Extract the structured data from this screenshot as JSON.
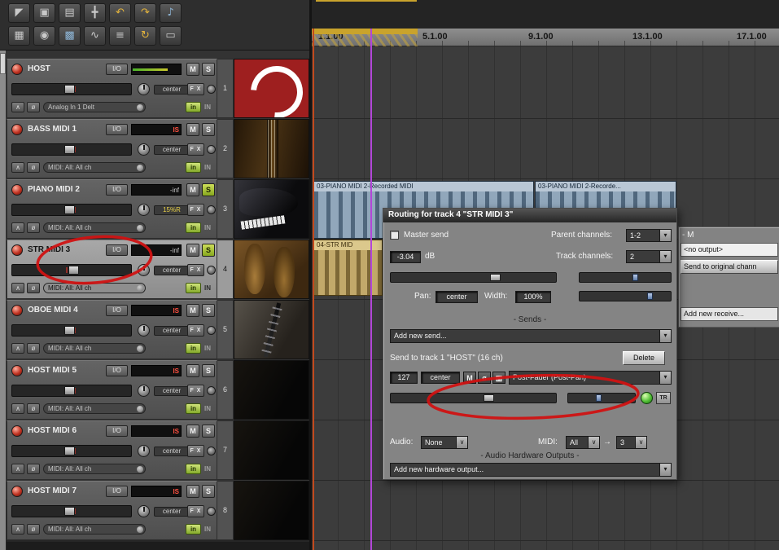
{
  "glyphs": {
    "dropdown_arrow": "▾",
    "chevron": "∨",
    "phase": "ø",
    "collapse": "∧",
    "midi_out": "▥",
    "tr_mode": "TR"
  },
  "toolbar": {
    "icons": [
      {
        "name": "pointer-tool-icon",
        "glyph": "◤"
      },
      {
        "name": "item-edit-icon",
        "glyph": "▣"
      },
      {
        "name": "marquee-select-icon",
        "glyph": "▤"
      },
      {
        "name": "actions-icon",
        "glyph": "╋"
      },
      {
        "name": "undo-icon",
        "glyph": "↶"
      },
      {
        "name": "redo-icon",
        "glyph": "↷"
      },
      {
        "name": "metronome-icon",
        "glyph": "♪"
      },
      {
        "name": "mixer-icon",
        "glyph": "▦"
      },
      {
        "name": "record-mode-icon",
        "glyph": "◉"
      },
      {
        "name": "routing-matrix-icon",
        "glyph": "▩"
      },
      {
        "name": "envelope-icon",
        "glyph": "∿"
      },
      {
        "name": "midi-editor-icon",
        "glyph": "≡"
      },
      {
        "name": "loop-icon",
        "glyph": "↻"
      },
      {
        "name": "docker-icon",
        "glyph": "▭"
      }
    ]
  },
  "ui": {
    "io": "I/O",
    "mute": "M",
    "solo": "S",
    "fx": "F X",
    "input_fx": "in",
    "input_label": "IN"
  },
  "tracks": [
    {
      "num": "1",
      "name": "HOST",
      "pan": "center",
      "routing": "Analog In 1 Delt",
      "meter": ""
    },
    {
      "num": "2",
      "name": "BASS MIDI 1",
      "pan": "center",
      "routing": "MIDI: All: All ch",
      "meter": "IS"
    },
    {
      "num": "3",
      "name": "PIANO MIDI 2",
      "pan": "15%R",
      "routing": "MIDI: All: All ch",
      "meter": "-inf"
    },
    {
      "num": "4",
      "name": "STR MIDI 3",
      "pan": "center",
      "routing": "MIDI: All: All ch",
      "meter": "-inf"
    },
    {
      "num": "5",
      "name": "OBOE MIDI 4",
      "pan": "center",
      "routing": "MIDI: All: All ch",
      "meter": "IS"
    },
    {
      "num": "6",
      "name": "HOST MIDI 5",
      "pan": "center",
      "routing": "MIDI: All: All ch",
      "meter": "IS"
    },
    {
      "num": "7",
      "name": "HOST MIDI 6",
      "pan": "center",
      "routing": "MIDI: All: All ch",
      "meter": "IS"
    },
    {
      "num": "8",
      "name": "HOST MIDI 7",
      "pan": "center",
      "routing": "MIDI: All: All ch",
      "meter": "IS"
    }
  ],
  "ruler": {
    "marks": [
      "1.1.00",
      "5.1.00",
      "9.1.00",
      "13.1.00",
      "17.1.00"
    ]
  },
  "items": {
    "piano1": "03-PIANO MIDI 2-Recorded MIDI",
    "piano2": "03-PIANO MIDI 2-Recorde...",
    "str": "04-STR MID"
  },
  "dialog": {
    "title": "Routing for track 4 \"STR MIDI 3\"",
    "master_send": "Master send",
    "parent_channels_label": "Parent channels:",
    "parent_channels_value": "1-2",
    "volume_value": "-3.04",
    "db_label": "dB",
    "track_channels_label": "Track channels:",
    "track_channels_value": "2",
    "pan_label": "Pan:",
    "pan_value": "center",
    "width_label": "Width:",
    "width_value": "100%",
    "sends_header": "- Sends -",
    "add_send": "Add new send...",
    "send_target": "Send to track 1 \"HOST\" (16 ch)",
    "delete_button": "Delete",
    "send_volume": "127",
    "send_pan": "center",
    "mute": "M",
    "send_mode": "Post-Fader (Post-Pan)",
    "audio_label": "Audio:",
    "audio_value": "None",
    "midi_label": "MIDI:",
    "midi_value": "All",
    "midi_arrow": "→",
    "midi_channel": "3",
    "hw_header": "- Audio Hardware Outputs -",
    "add_hw": "Add new hardware output..."
  },
  "right_panel": {
    "header_fragment": "- M",
    "no_output": "<no output>",
    "send_original": "Send to original chann",
    "add_receive": "Add new receive..."
  },
  "colors": {
    "annotation": "#d01212",
    "selected_track": "#9a9a9a",
    "solo_active": "#a8c63c",
    "loop_bar": "#c9a32c",
    "item_piano": "#93a8bc",
    "item_strings": "#c2a96a",
    "cursor_purple": "#b246d8",
    "cursor_orange": "#c3491c"
  }
}
